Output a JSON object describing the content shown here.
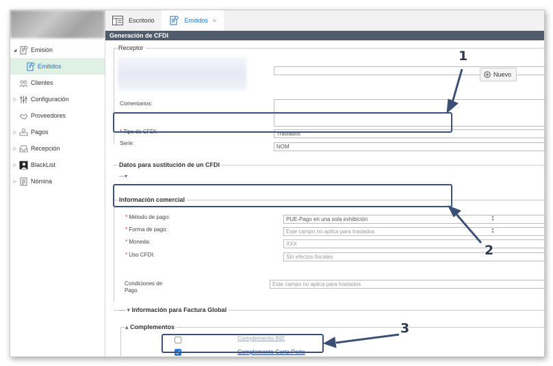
{
  "tabs": [
    {
      "label": "Escritorio",
      "icon": "dashboard-icon"
    },
    {
      "label": "Emitidos",
      "icon": "invoice-icon",
      "close": "⨯"
    }
  ],
  "sidebar": {
    "items": [
      {
        "label": "Emisión",
        "icon": "invoice-icon"
      },
      {
        "label": "Emitidos",
        "icon": "invoice-icon"
      },
      {
        "label": "Clientes",
        "icon": "users-icon"
      },
      {
        "label": "Configuración",
        "icon": "sliders-icon"
      },
      {
        "label": "Proveedores",
        "icon": "handshake-icon"
      },
      {
        "label": "Pagos",
        "icon": "payment-icon"
      },
      {
        "label": "Recepción",
        "icon": "inbox-icon"
      },
      {
        "label": "BlackList",
        "icon": "blacklist-icon"
      },
      {
        "label": "Nómina",
        "icon": "payroll-icon"
      }
    ]
  },
  "form": {
    "title": "Generación de CFDI",
    "receptor": {
      "legend": "Receptor",
      "nuevo_label": "Nuevo",
      "comentarios_label": "Comentarios:",
      "tipo_cfdi_label": "Tipo de CFDI:",
      "tipo_cfdi_value": "Traslados",
      "serie_label": "Serie:",
      "serie_value": "NOM",
      "required_mark": "*"
    },
    "sustitucion": {
      "legend": "Datos para sustitución de un CFDI",
      "toggle": "—▾"
    },
    "comercial": {
      "legend": "Información comercial",
      "metodo_label": "Método de pago:",
      "metodo_value": "PUE-Pago en una sola exhibición",
      "forma_label": "Forma de pago:",
      "forma_value": "Este campo no aplica para traslados",
      "moneda_label": "Moneda:",
      "moneda_value": "XXX",
      "uso_label": "Uso CFDI:",
      "uso_value": "Sin efectos fiscales",
      "condiciones_label": "Condiciones de Pago",
      "condiciones_value": "Este campo no aplica para traslados"
    },
    "factura_global": {
      "legend": "Información para Factura Global",
      "toggle": "— ▾"
    },
    "complementos": {
      "legend": "Complementos",
      "toggle": "▴",
      "items": [
        {
          "label": "Complemento INE",
          "checked": false
        },
        {
          "label": "Complemento Carta Porte",
          "checked": true
        }
      ]
    }
  },
  "annotations": [
    "1",
    "2",
    "3"
  ],
  "colors": {
    "accent": "#1e73be",
    "callout": "#3b4e73",
    "titlebar": "#515c6b",
    "active_bg": "#dff1e4"
  }
}
